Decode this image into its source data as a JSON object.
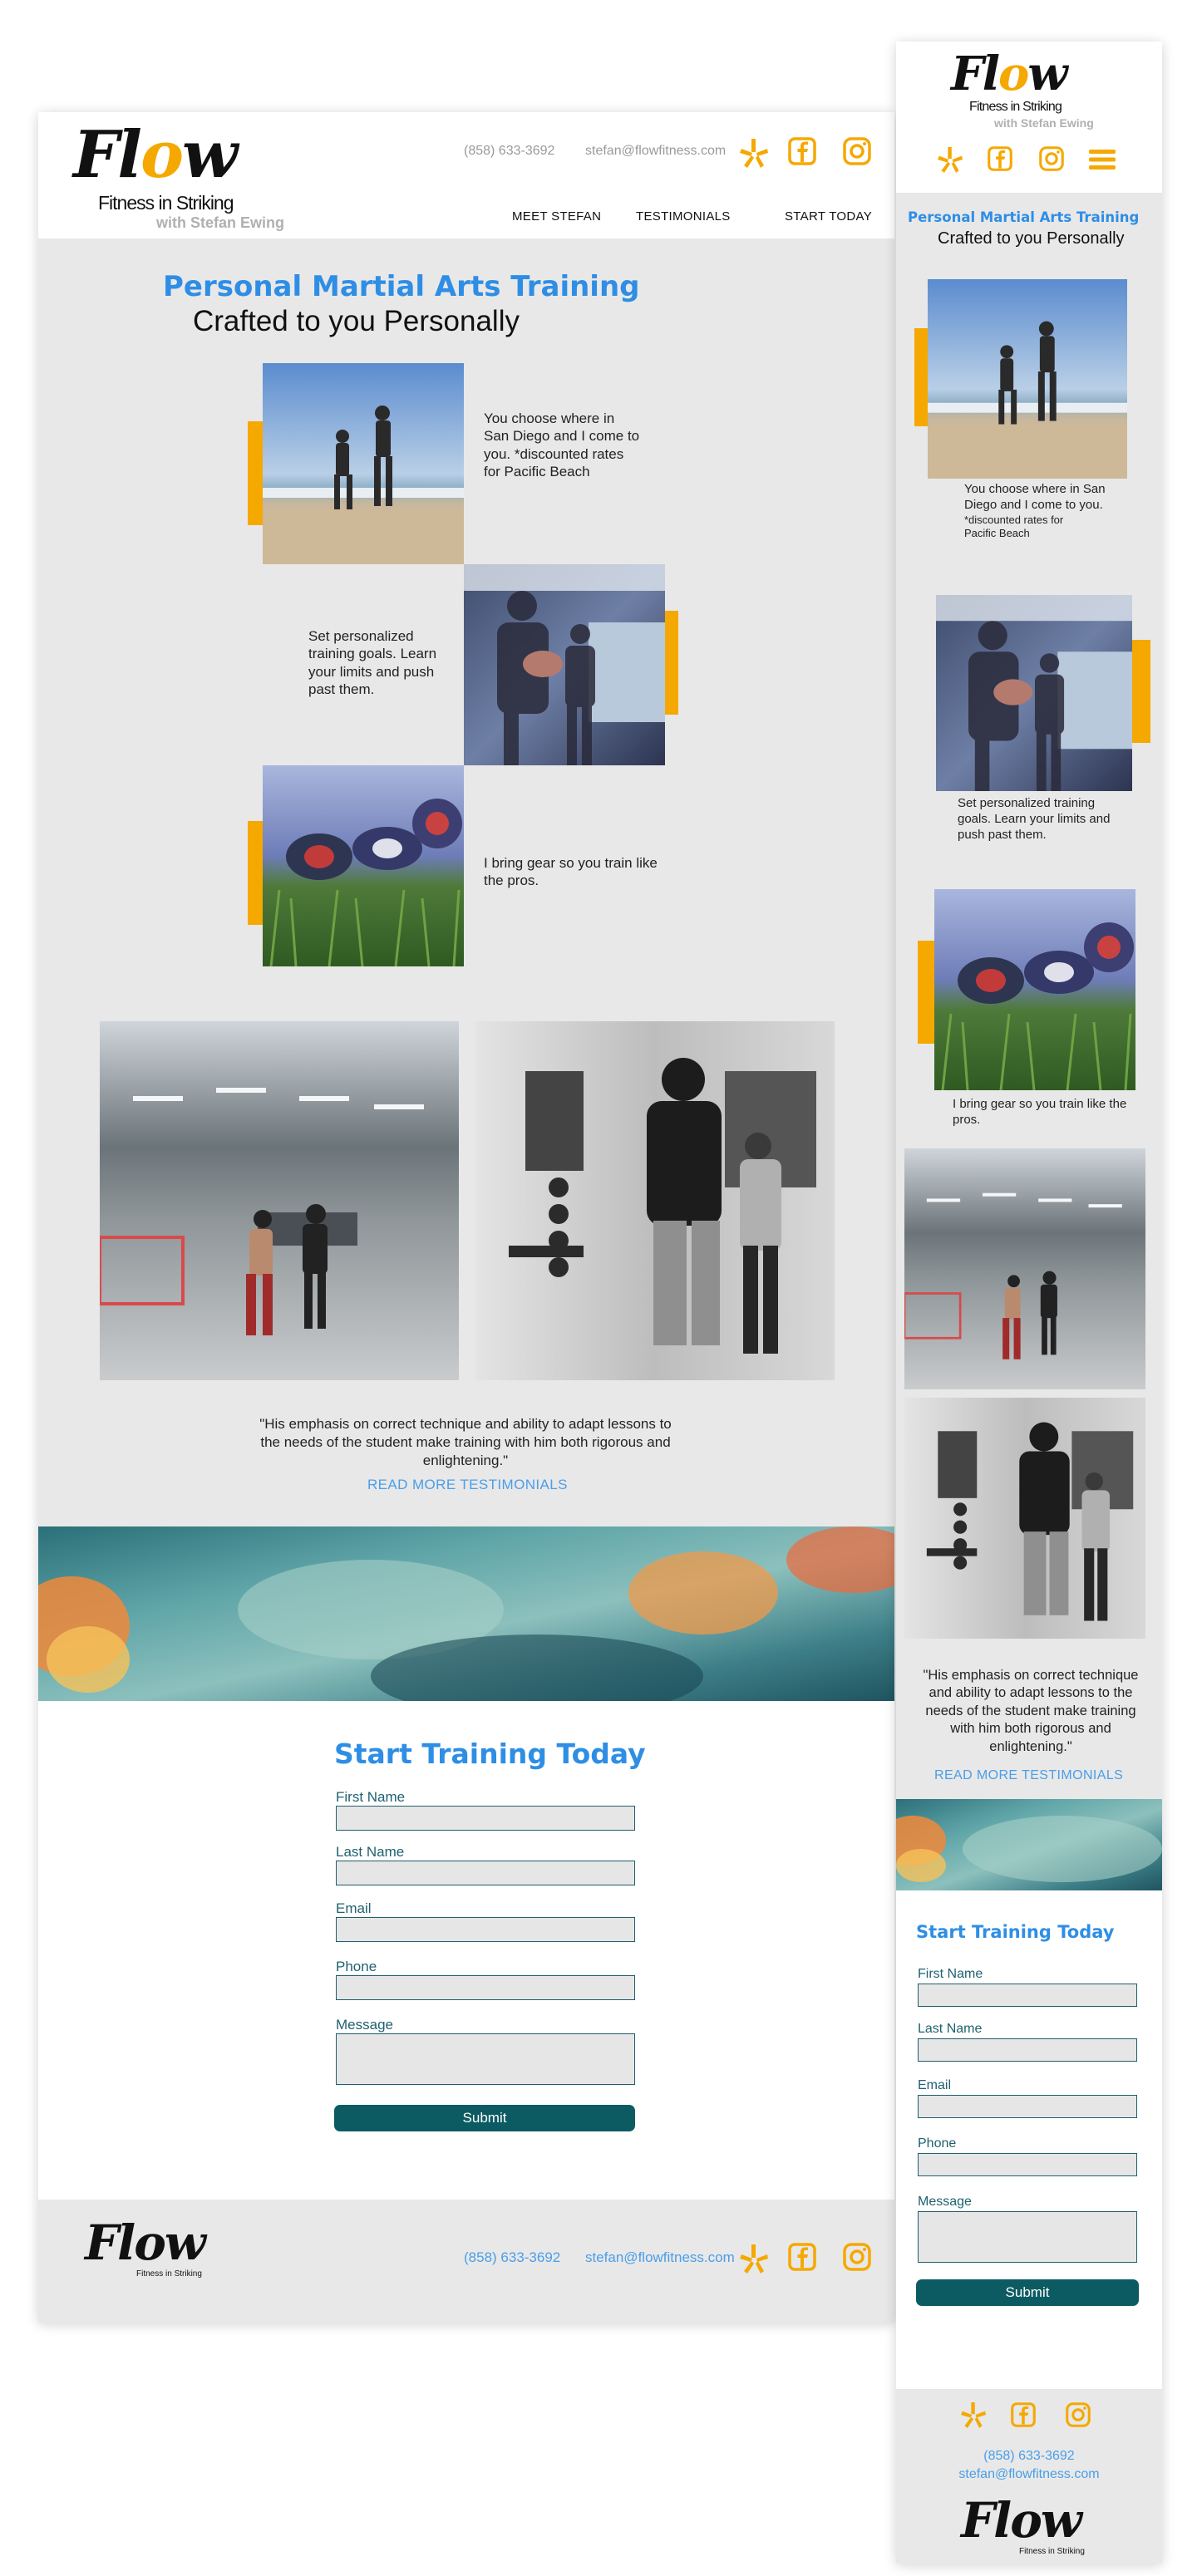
{
  "brand": {
    "logo_word_pre": "Fl",
    "logo_word_o": "o",
    "logo_word_post": "w",
    "tagline": "Fitness in Striking",
    "subtitle": "with Stefan Ewing",
    "accent_color": "#f5a800",
    "title_color": "#2e8ee5",
    "button_color": "#0d5b62"
  },
  "contact": {
    "phone": "(858) 633-3692",
    "email": "stefan@flowfitness.com"
  },
  "social_icons": [
    "yelp-icon",
    "facebook-icon",
    "instagram-icon"
  ],
  "nav": {
    "items": [
      "MEET STEFAN",
      "TESTIMONIALS",
      "START TODAY"
    ],
    "mobile_menu_icon": "hamburger-menu-icon"
  },
  "hero": {
    "title": "Personal Martial Arts Training",
    "subtitle": "Crafted to you Personally"
  },
  "features": [
    {
      "text": "You choose where in San Diego and I come to you.",
      "note": "*discounted rates for Pacific Beach"
    },
    {
      "text": "Set personalized training goals. Learn your limits and push past them.",
      "note": ""
    },
    {
      "text": "I bring gear so you train like the pros.",
      "note": ""
    }
  ],
  "testimonial": {
    "quote": "\"His emphasis on correct technique and ability to adapt lessons to the needs of the student make training with him both rigorous and enlightening.\"",
    "link": "READ MORE TESTIMONIALS"
  },
  "form": {
    "title": "Start Training Today",
    "fields": [
      "First Name",
      "Last Name",
      "Email",
      "Phone",
      "Message"
    ],
    "submit": "Submit"
  }
}
